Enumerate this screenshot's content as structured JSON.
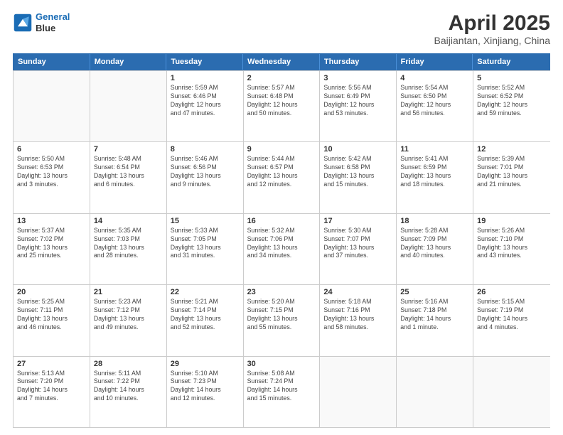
{
  "header": {
    "logo_line1": "General",
    "logo_line2": "Blue",
    "month_year": "April 2025",
    "location": "Baijiantan, Xinjiang, China"
  },
  "weekdays": [
    "Sunday",
    "Monday",
    "Tuesday",
    "Wednesday",
    "Thursday",
    "Friday",
    "Saturday"
  ],
  "rows": [
    [
      {
        "day": "",
        "info": ""
      },
      {
        "day": "",
        "info": ""
      },
      {
        "day": "1",
        "info": "Sunrise: 5:59 AM\nSunset: 6:46 PM\nDaylight: 12 hours\nand 47 minutes."
      },
      {
        "day": "2",
        "info": "Sunrise: 5:57 AM\nSunset: 6:48 PM\nDaylight: 12 hours\nand 50 minutes."
      },
      {
        "day": "3",
        "info": "Sunrise: 5:56 AM\nSunset: 6:49 PM\nDaylight: 12 hours\nand 53 minutes."
      },
      {
        "day": "4",
        "info": "Sunrise: 5:54 AM\nSunset: 6:50 PM\nDaylight: 12 hours\nand 56 minutes."
      },
      {
        "day": "5",
        "info": "Sunrise: 5:52 AM\nSunset: 6:52 PM\nDaylight: 12 hours\nand 59 minutes."
      }
    ],
    [
      {
        "day": "6",
        "info": "Sunrise: 5:50 AM\nSunset: 6:53 PM\nDaylight: 13 hours\nand 3 minutes."
      },
      {
        "day": "7",
        "info": "Sunrise: 5:48 AM\nSunset: 6:54 PM\nDaylight: 13 hours\nand 6 minutes."
      },
      {
        "day": "8",
        "info": "Sunrise: 5:46 AM\nSunset: 6:56 PM\nDaylight: 13 hours\nand 9 minutes."
      },
      {
        "day": "9",
        "info": "Sunrise: 5:44 AM\nSunset: 6:57 PM\nDaylight: 13 hours\nand 12 minutes."
      },
      {
        "day": "10",
        "info": "Sunrise: 5:42 AM\nSunset: 6:58 PM\nDaylight: 13 hours\nand 15 minutes."
      },
      {
        "day": "11",
        "info": "Sunrise: 5:41 AM\nSunset: 6:59 PM\nDaylight: 13 hours\nand 18 minutes."
      },
      {
        "day": "12",
        "info": "Sunrise: 5:39 AM\nSunset: 7:01 PM\nDaylight: 13 hours\nand 21 minutes."
      }
    ],
    [
      {
        "day": "13",
        "info": "Sunrise: 5:37 AM\nSunset: 7:02 PM\nDaylight: 13 hours\nand 25 minutes."
      },
      {
        "day": "14",
        "info": "Sunrise: 5:35 AM\nSunset: 7:03 PM\nDaylight: 13 hours\nand 28 minutes."
      },
      {
        "day": "15",
        "info": "Sunrise: 5:33 AM\nSunset: 7:05 PM\nDaylight: 13 hours\nand 31 minutes."
      },
      {
        "day": "16",
        "info": "Sunrise: 5:32 AM\nSunset: 7:06 PM\nDaylight: 13 hours\nand 34 minutes."
      },
      {
        "day": "17",
        "info": "Sunrise: 5:30 AM\nSunset: 7:07 PM\nDaylight: 13 hours\nand 37 minutes."
      },
      {
        "day": "18",
        "info": "Sunrise: 5:28 AM\nSunset: 7:09 PM\nDaylight: 13 hours\nand 40 minutes."
      },
      {
        "day": "19",
        "info": "Sunrise: 5:26 AM\nSunset: 7:10 PM\nDaylight: 13 hours\nand 43 minutes."
      }
    ],
    [
      {
        "day": "20",
        "info": "Sunrise: 5:25 AM\nSunset: 7:11 PM\nDaylight: 13 hours\nand 46 minutes."
      },
      {
        "day": "21",
        "info": "Sunrise: 5:23 AM\nSunset: 7:12 PM\nDaylight: 13 hours\nand 49 minutes."
      },
      {
        "day": "22",
        "info": "Sunrise: 5:21 AM\nSunset: 7:14 PM\nDaylight: 13 hours\nand 52 minutes."
      },
      {
        "day": "23",
        "info": "Sunrise: 5:20 AM\nSunset: 7:15 PM\nDaylight: 13 hours\nand 55 minutes."
      },
      {
        "day": "24",
        "info": "Sunrise: 5:18 AM\nSunset: 7:16 PM\nDaylight: 13 hours\nand 58 minutes."
      },
      {
        "day": "25",
        "info": "Sunrise: 5:16 AM\nSunset: 7:18 PM\nDaylight: 14 hours\nand 1 minute."
      },
      {
        "day": "26",
        "info": "Sunrise: 5:15 AM\nSunset: 7:19 PM\nDaylight: 14 hours\nand 4 minutes."
      }
    ],
    [
      {
        "day": "27",
        "info": "Sunrise: 5:13 AM\nSunset: 7:20 PM\nDaylight: 14 hours\nand 7 minutes."
      },
      {
        "day": "28",
        "info": "Sunrise: 5:11 AM\nSunset: 7:22 PM\nDaylight: 14 hours\nand 10 minutes."
      },
      {
        "day": "29",
        "info": "Sunrise: 5:10 AM\nSunset: 7:23 PM\nDaylight: 14 hours\nand 12 minutes."
      },
      {
        "day": "30",
        "info": "Sunrise: 5:08 AM\nSunset: 7:24 PM\nDaylight: 14 hours\nand 15 minutes."
      },
      {
        "day": "",
        "info": ""
      },
      {
        "day": "",
        "info": ""
      },
      {
        "day": "",
        "info": ""
      }
    ]
  ]
}
